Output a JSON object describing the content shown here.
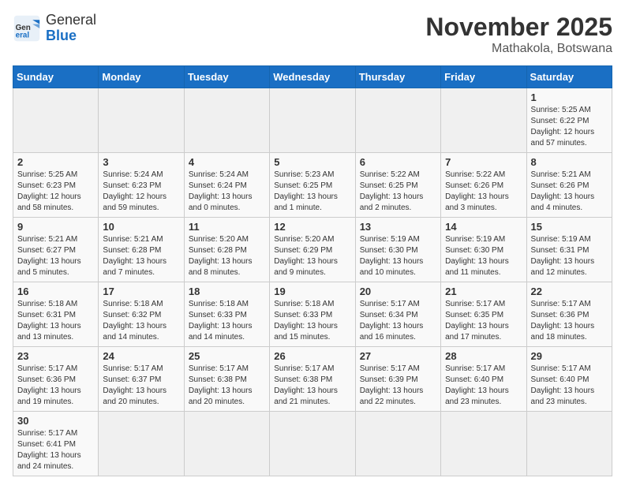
{
  "header": {
    "logo_general": "General",
    "logo_blue": "Blue",
    "month_title": "November 2025",
    "location": "Mathakola, Botswana"
  },
  "weekdays": [
    "Sunday",
    "Monday",
    "Tuesday",
    "Wednesday",
    "Thursday",
    "Friday",
    "Saturday"
  ],
  "days": {
    "1": {
      "sunrise": "Sunrise: 5:25 AM",
      "sunset": "Sunset: 6:22 PM",
      "daylight": "Daylight: 12 hours and 57 minutes."
    },
    "2": {
      "sunrise": "Sunrise: 5:25 AM",
      "sunset": "Sunset: 6:23 PM",
      "daylight": "Daylight: 12 hours and 58 minutes."
    },
    "3": {
      "sunrise": "Sunrise: 5:24 AM",
      "sunset": "Sunset: 6:23 PM",
      "daylight": "Daylight: 12 hours and 59 minutes."
    },
    "4": {
      "sunrise": "Sunrise: 5:24 AM",
      "sunset": "Sunset: 6:24 PM",
      "daylight": "Daylight: 13 hours and 0 minutes."
    },
    "5": {
      "sunrise": "Sunrise: 5:23 AM",
      "sunset": "Sunset: 6:25 PM",
      "daylight": "Daylight: 13 hours and 1 minute."
    },
    "6": {
      "sunrise": "Sunrise: 5:22 AM",
      "sunset": "Sunset: 6:25 PM",
      "daylight": "Daylight: 13 hours and 2 minutes."
    },
    "7": {
      "sunrise": "Sunrise: 5:22 AM",
      "sunset": "Sunset: 6:26 PM",
      "daylight": "Daylight: 13 hours and 3 minutes."
    },
    "8": {
      "sunrise": "Sunrise: 5:21 AM",
      "sunset": "Sunset: 6:26 PM",
      "daylight": "Daylight: 13 hours and 4 minutes."
    },
    "9": {
      "sunrise": "Sunrise: 5:21 AM",
      "sunset": "Sunset: 6:27 PM",
      "daylight": "Daylight: 13 hours and 5 minutes."
    },
    "10": {
      "sunrise": "Sunrise: 5:21 AM",
      "sunset": "Sunset: 6:28 PM",
      "daylight": "Daylight: 13 hours and 7 minutes."
    },
    "11": {
      "sunrise": "Sunrise: 5:20 AM",
      "sunset": "Sunset: 6:28 PM",
      "daylight": "Daylight: 13 hours and 8 minutes."
    },
    "12": {
      "sunrise": "Sunrise: 5:20 AM",
      "sunset": "Sunset: 6:29 PM",
      "daylight": "Daylight: 13 hours and 9 minutes."
    },
    "13": {
      "sunrise": "Sunrise: 5:19 AM",
      "sunset": "Sunset: 6:30 PM",
      "daylight": "Daylight: 13 hours and 10 minutes."
    },
    "14": {
      "sunrise": "Sunrise: 5:19 AM",
      "sunset": "Sunset: 6:30 PM",
      "daylight": "Daylight: 13 hours and 11 minutes."
    },
    "15": {
      "sunrise": "Sunrise: 5:19 AM",
      "sunset": "Sunset: 6:31 PM",
      "daylight": "Daylight: 13 hours and 12 minutes."
    },
    "16": {
      "sunrise": "Sunrise: 5:18 AM",
      "sunset": "Sunset: 6:31 PM",
      "daylight": "Daylight: 13 hours and 13 minutes."
    },
    "17": {
      "sunrise": "Sunrise: 5:18 AM",
      "sunset": "Sunset: 6:32 PM",
      "daylight": "Daylight: 13 hours and 14 minutes."
    },
    "18": {
      "sunrise": "Sunrise: 5:18 AM",
      "sunset": "Sunset: 6:33 PM",
      "daylight": "Daylight: 13 hours and 14 minutes."
    },
    "19": {
      "sunrise": "Sunrise: 5:18 AM",
      "sunset": "Sunset: 6:33 PM",
      "daylight": "Daylight: 13 hours and 15 minutes."
    },
    "20": {
      "sunrise": "Sunrise: 5:17 AM",
      "sunset": "Sunset: 6:34 PM",
      "daylight": "Daylight: 13 hours and 16 minutes."
    },
    "21": {
      "sunrise": "Sunrise: 5:17 AM",
      "sunset": "Sunset: 6:35 PM",
      "daylight": "Daylight: 13 hours and 17 minutes."
    },
    "22": {
      "sunrise": "Sunrise: 5:17 AM",
      "sunset": "Sunset: 6:36 PM",
      "daylight": "Daylight: 13 hours and 18 minutes."
    },
    "23": {
      "sunrise": "Sunrise: 5:17 AM",
      "sunset": "Sunset: 6:36 PM",
      "daylight": "Daylight: 13 hours and 19 minutes."
    },
    "24": {
      "sunrise": "Sunrise: 5:17 AM",
      "sunset": "Sunset: 6:37 PM",
      "daylight": "Daylight: 13 hours and 20 minutes."
    },
    "25": {
      "sunrise": "Sunrise: 5:17 AM",
      "sunset": "Sunset: 6:38 PM",
      "daylight": "Daylight: 13 hours and 20 minutes."
    },
    "26": {
      "sunrise": "Sunrise: 5:17 AM",
      "sunset": "Sunset: 6:38 PM",
      "daylight": "Daylight: 13 hours and 21 minutes."
    },
    "27": {
      "sunrise": "Sunrise: 5:17 AM",
      "sunset": "Sunset: 6:39 PM",
      "daylight": "Daylight: 13 hours and 22 minutes."
    },
    "28": {
      "sunrise": "Sunrise: 5:17 AM",
      "sunset": "Sunset: 6:40 PM",
      "daylight": "Daylight: 13 hours and 23 minutes."
    },
    "29": {
      "sunrise": "Sunrise: 5:17 AM",
      "sunset": "Sunset: 6:40 PM",
      "daylight": "Daylight: 13 hours and 23 minutes."
    },
    "30": {
      "sunrise": "Sunrise: 5:17 AM",
      "sunset": "Sunset: 6:41 PM",
      "daylight": "Daylight: 13 hours and 24 minutes."
    }
  }
}
